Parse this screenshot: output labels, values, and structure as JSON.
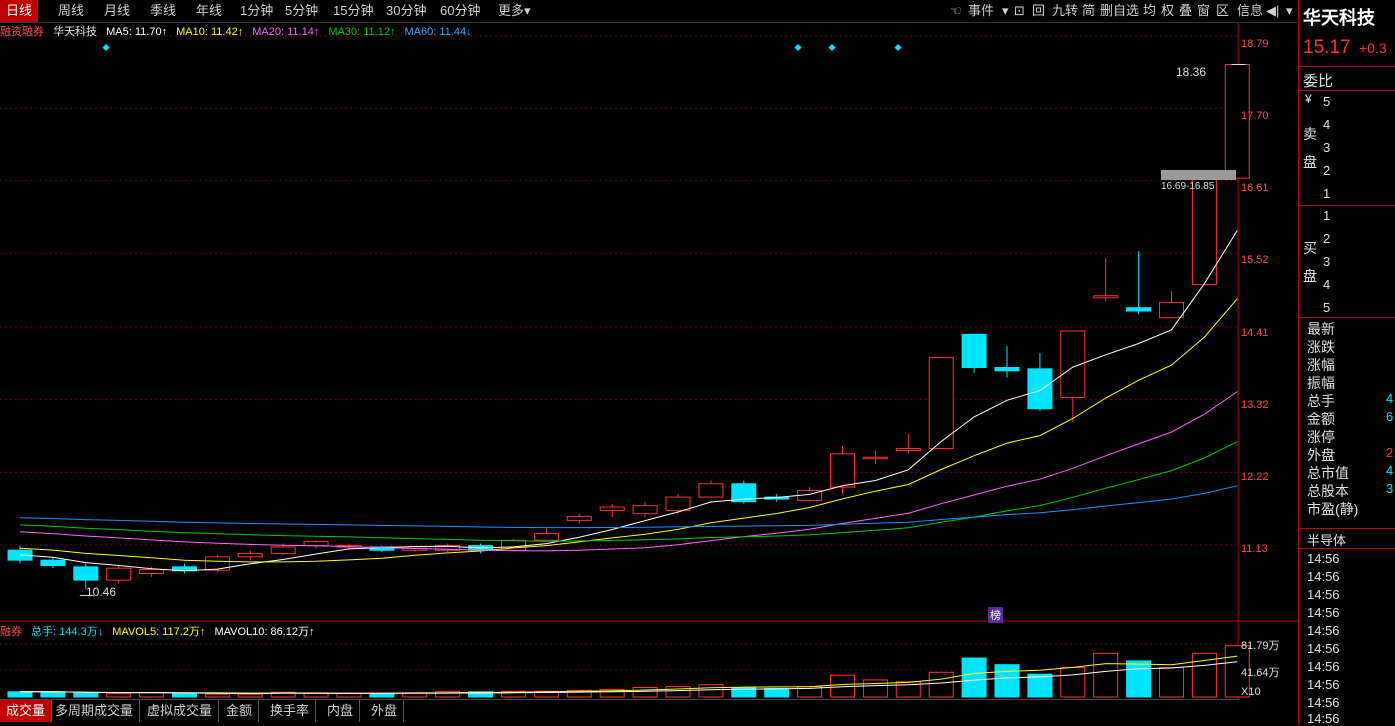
{
  "top_tabs": [
    "日线",
    "周线",
    "月线",
    "季线",
    "年线",
    "1分钟",
    "5分钟",
    "15分钟",
    "30分钟",
    "60分钟",
    "更多▾"
  ],
  "top_right": [
    "事件",
    "回",
    "九转",
    "简",
    "删自选",
    "均",
    "权",
    "叠",
    "窗",
    "区",
    "信息"
  ],
  "stock": {
    "name": "华天科技",
    "price": "15.17",
    "change": "+0.3"
  },
  "ma_line": {
    "prefix": "融资融券",
    "name": "华天科技",
    "ma5": "MA5: 11.70↑",
    "ma10": "MA10: 11.42↑",
    "ma20": "MA20: 11.14↑",
    "ma30": "MA30: 11.12↑",
    "ma60": "MA60: 11.44↓"
  },
  "y_axis": [
    "18.79",
    "17.70",
    "16.61",
    "15.52",
    "14.41",
    "13.32",
    "12.22",
    "11.13"
  ],
  "annotations": {
    "high": "18.36",
    "low": "10.46",
    "range": "16.69-16.85",
    "badge": "榜"
  },
  "vol_line": {
    "prefix": "融券",
    "total": "总手: 144.3万↓",
    "mavol5": "MAVOL5: 117.2万↑",
    "mavol10": "MAVOL10: 86.12万↑"
  },
  "vol_axis": [
    "81.79万",
    "41.64万",
    "X10"
  ],
  "bottom_tabs": [
    "成交量",
    "多周期成交量",
    "虚拟成交量",
    "金额",
    "换手率",
    "内盘",
    "外盘"
  ],
  "side": {
    "weibi": "委比",
    "sell_label": [
      "卖",
      "盘"
    ],
    "buy_label": [
      "买",
      "盘"
    ],
    "yen": "¥",
    "sell_levels": [
      "5",
      "4",
      "3",
      "2",
      "1"
    ],
    "buy_levels": [
      "1",
      "2",
      "3",
      "4",
      "5"
    ],
    "stats": [
      "最新",
      "涨跌",
      "涨幅",
      "振幅",
      "总手",
      "金额",
      "涨停",
      "外盘",
      "总市值",
      "总股本",
      "市盈(静)"
    ],
    "stat_vals": [
      "",
      "",
      "",
      "",
      "4",
      "6",
      "",
      "2",
      "4",
      "3",
      ""
    ],
    "sector": "半导体",
    "times": [
      "14:56",
      "14:56",
      "14:56",
      "14:56",
      "14:56",
      "14:56",
      "14:56",
      "14:56",
      "14:56",
      "14:56"
    ]
  },
  "chart_data": {
    "type": "candlestick",
    "ylim": [
      10.0,
      19.0
    ],
    "candles": [
      [
        11.05,
        10.9,
        11.12,
        10.85
      ],
      [
        10.9,
        10.82,
        10.95,
        10.78
      ],
      [
        10.8,
        10.6,
        10.85,
        10.46
      ],
      [
        10.6,
        10.78,
        10.82,
        10.55
      ],
      [
        10.7,
        10.76,
        10.8,
        10.65
      ],
      [
        10.8,
        10.74,
        10.85,
        10.7
      ],
      [
        10.75,
        10.95,
        10.98,
        10.72
      ],
      [
        10.95,
        11.0,
        11.05,
        10.9
      ],
      [
        11.0,
        11.1,
        11.15,
        10.98
      ],
      [
        11.12,
        11.18,
        11.2,
        11.08
      ],
      [
        11.1,
        11.12,
        11.15,
        11.06
      ],
      [
        11.1,
        11.05,
        11.12,
        11.02
      ],
      [
        11.05,
        11.08,
        11.1,
        11.03
      ],
      [
        11.05,
        11.12,
        11.15,
        11.02
      ],
      [
        11.12,
        11.05,
        11.15,
        11.0
      ],
      [
        11.05,
        11.2,
        11.22,
        11.04
      ],
      [
        11.2,
        11.3,
        11.38,
        11.18
      ],
      [
        11.5,
        11.56,
        11.6,
        11.45
      ],
      [
        11.65,
        11.7,
        11.75,
        11.55
      ],
      [
        11.6,
        11.72,
        11.78,
        11.55
      ],
      [
        11.65,
        11.85,
        11.9,
        11.6
      ],
      [
        11.85,
        12.05,
        12.1,
        11.85
      ],
      [
        12.05,
        11.78,
        12.1,
        11.75
      ],
      [
        11.85,
        11.82,
        11.9,
        11.78
      ],
      [
        11.8,
        11.95,
        12.0,
        11.78
      ],
      [
        12.0,
        12.5,
        12.62,
        11.9
      ],
      [
        12.45,
        12.45,
        12.55,
        12.35
      ],
      [
        12.55,
        12.58,
        12.8,
        12.5
      ],
      [
        12.58,
        13.95,
        13.95,
        12.58
      ],
      [
        14.3,
        13.8,
        14.3,
        13.72
      ],
      [
        13.8,
        13.75,
        14.12,
        13.65
      ],
      [
        13.78,
        13.18,
        14.02,
        13.15
      ],
      [
        13.35,
        14.35,
        14.35,
        12.98
      ],
      [
        14.85,
        14.88,
        15.45,
        14.8
      ],
      [
        14.7,
        14.65,
        15.55,
        14.6
      ],
      [
        14.55,
        14.78,
        14.95,
        14.55
      ],
      [
        15.05,
        16.65,
        16.65,
        15.05
      ],
      [
        16.65,
        18.36,
        18.36,
        16.65
      ]
    ],
    "volume": [
      0.55,
      0.55,
      0.4,
      0.35,
      0.45,
      0.4,
      0.3,
      0.3,
      0.5,
      0.4,
      0.4,
      0.35,
      0.45,
      0.6,
      0.55,
      0.6,
      0.6,
      0.7,
      0.8,
      1.0,
      1.1,
      1.3,
      1.0,
      0.9,
      1.1,
      2.3,
      1.8,
      1.6,
      2.6,
      4.1,
      3.4,
      2.4,
      3.1,
      4.6,
      3.8,
      3.1,
      4.6,
      5.4
    ]
  },
  "colors": {
    "up": "#ff3232",
    "down": "#00e5ff",
    "ma5": "#ffffff",
    "ma10": "#ffff00",
    "ma20": "#ff66ff",
    "ma30": "#00cc00",
    "ma60": "#1e90ff"
  }
}
